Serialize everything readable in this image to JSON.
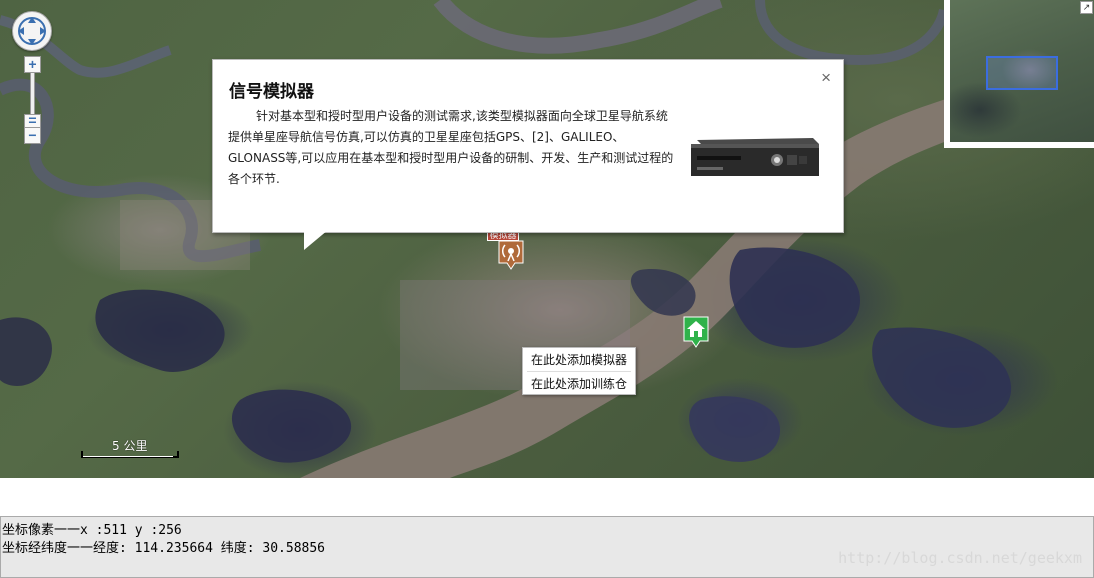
{
  "map": {
    "info_window": {
      "title": "信号模拟器",
      "body": "针对基本型和授时型用户设备的测试需求,该类型模拟器面向全球卫星导航系统提供单星座导航信号仿真,可以仿真的卫星星座包括GPS、[2]、GALILEO、GLONASS等,可以应用在基本型和授时型用户设备的研制、开发、生产和测试过程的各个环节.",
      "close": "×",
      "image": "signal-simulator-device"
    },
    "context_menu": {
      "items": [
        "在此处添加模拟器",
        "在此处添加训练仓"
      ]
    },
    "scale": {
      "label": "5 公里"
    },
    "markers": {
      "simulator_label": "模拟器",
      "simulator_icon": "antenna-icon",
      "house_icon": "house-icon"
    },
    "zoom": {
      "in": "+",
      "out": "−",
      "mid": "="
    }
  },
  "coords": {
    "pixel_line": "坐标像素一一x :511 y :256",
    "lnglat_line": "坐标经纬度一一经度: 114.235664 纬度: 30.58856"
  },
  "watermark": "http://blog.csdn.net/geekxm",
  "colors": {
    "accent": "#3a6fb0",
    "house_green": "#2fb24a",
    "marker_brown": "#b06a3a"
  }
}
